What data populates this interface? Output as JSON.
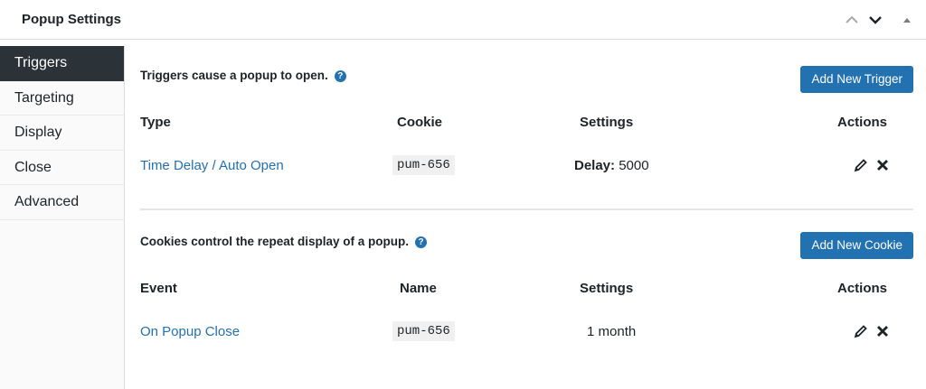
{
  "header": {
    "title": "Popup Settings"
  },
  "sidebar": {
    "tabs": [
      {
        "label": "Triggers",
        "active": true
      },
      {
        "label": "Targeting",
        "active": false
      },
      {
        "label": "Display",
        "active": false
      },
      {
        "label": "Close",
        "active": false
      },
      {
        "label": "Advanced",
        "active": false
      }
    ]
  },
  "triggers": {
    "intro": "Triggers cause a popup to open.",
    "add_button": "Add New Trigger",
    "columns": {
      "type": "Type",
      "cookie": "Cookie",
      "settings": "Settings",
      "actions": "Actions"
    },
    "rows": [
      {
        "type": "Time Delay / Auto Open",
        "cookie": "pum-656",
        "settings_label": "Delay:",
        "settings_value": "5000"
      }
    ]
  },
  "cookies": {
    "intro": "Cookies control the repeat display of a popup.",
    "add_button": "Add New Cookie",
    "columns": {
      "event": "Event",
      "name": "Name",
      "settings": "Settings",
      "actions": "Actions"
    },
    "rows": [
      {
        "event": "On Popup Close",
        "name": "pum-656",
        "settings": "1 month"
      }
    ]
  },
  "help_glyph": "?",
  "icons": [
    "chevron-up-icon",
    "chevron-down-icon",
    "triangle-up-icon",
    "pencil-icon",
    "x-icon"
  ],
  "colors": {
    "accent": "#2271b1",
    "active_tab": "#2c3338"
  }
}
